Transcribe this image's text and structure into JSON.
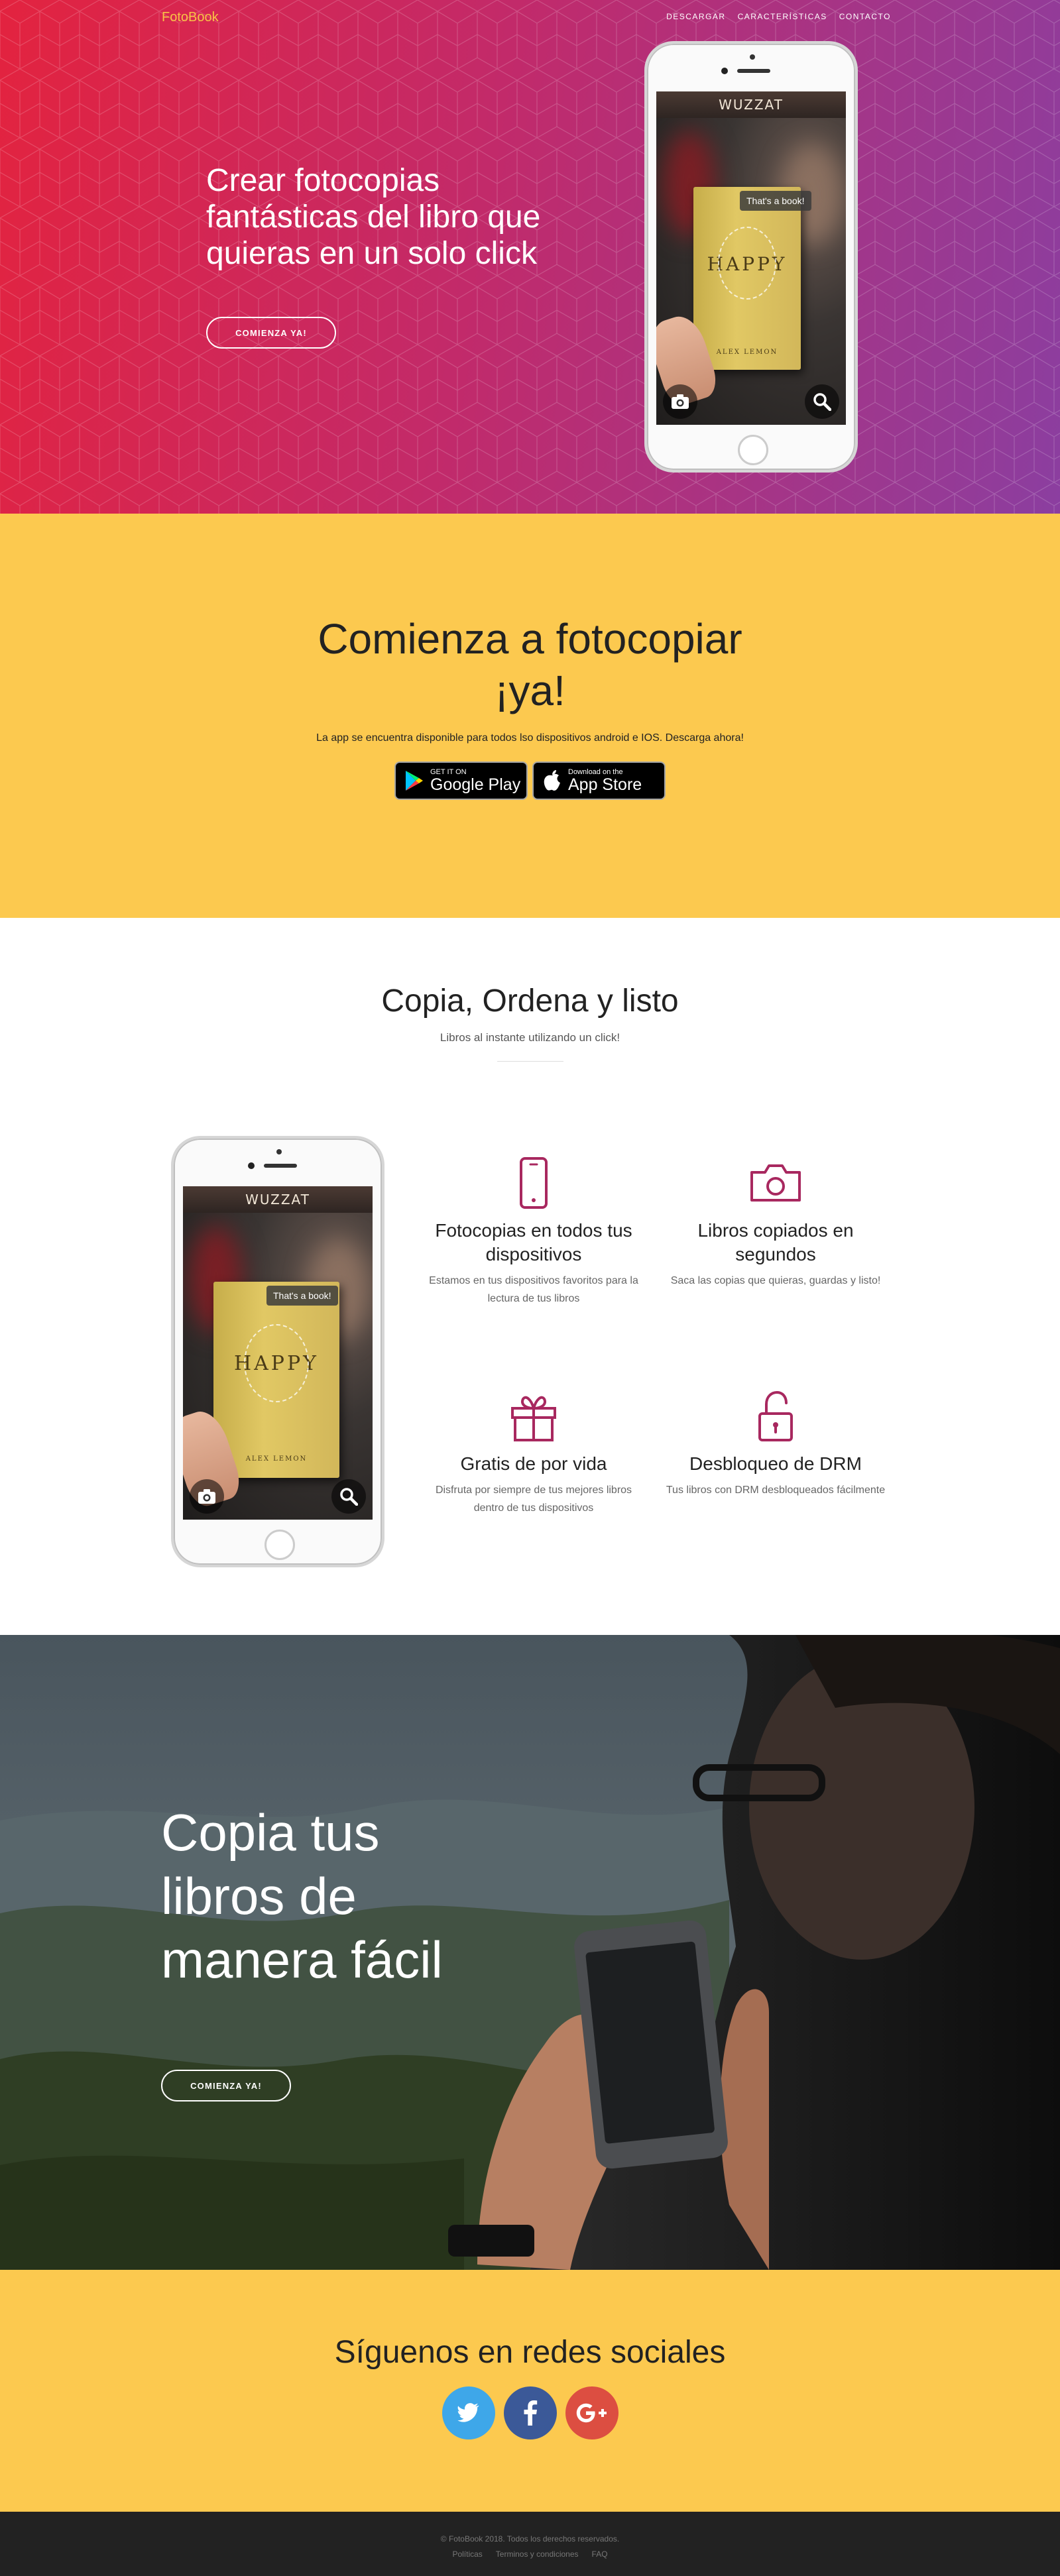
{
  "brand": "FotoBook",
  "nav": {
    "items": [
      "DESCARGAR",
      "CARACTERÍSTICAS",
      "CONTACTO"
    ]
  },
  "hero": {
    "title": "Crear fotocopias fantásticas del libro que quieras en un solo click",
    "button": "COMIENZA YA!"
  },
  "phone_screen": {
    "app_name": "WUZZAT",
    "bubble": "That's a book!",
    "book_title": "HAPPY",
    "book_author": "ALEX LEMON",
    "camera_icon": "camera-icon",
    "search_icon": "magnifier-icon"
  },
  "download": {
    "title": "Comienza a fotocopiar ¡ya!",
    "text": "La app se encuentra disponible para todos lso dispositivos android e IOS. Descarga ahora!",
    "google_small": "GET IT ON",
    "google_big": "Google Play",
    "apple_small": "Download on the",
    "apple_big": "App Store"
  },
  "features": {
    "title": "Copia, Ordena y listo",
    "subtitle": "Libros al instante utilizando un click!",
    "accent": "#a8285f",
    "items": [
      {
        "icon": "mobile-phone-icon",
        "title": "Fotocopias en todos tus dispositivos",
        "text": "Estamos en tus dispositivos favoritos para la lectura de tus libros"
      },
      {
        "icon": "camera-icon",
        "title": "Libros copiados en segundos",
        "text": "Saca las copias que quieras, guardas y listo!"
      },
      {
        "icon": "gift-icon",
        "title": "Gratis de por vida",
        "text": "Disfruta por siempre de tus mejores libros dentro de tus dispositivos"
      },
      {
        "icon": "unlocked-padlock-icon",
        "title": "Desbloqueo de DRM",
        "text": "Tus libros con DRM desbloqueados fácilmente"
      }
    ]
  },
  "cta": {
    "title": "Copia tus libros de manera fácil",
    "button": "COMIENZA YA!"
  },
  "social": {
    "title": "Síguenos en redes sociales",
    "twitter_color": "#3ea7e9",
    "facebook_color": "#3b5998",
    "google_color": "#dc4e41"
  },
  "footer": {
    "copyright": "© FotoBook 2018. Todos los derechos reservados.",
    "links": [
      "Políticas",
      "Terminos y condiciones",
      "FAQ"
    ]
  },
  "colors": {
    "hero_start": "#e3233f",
    "hero_end": "#8b3ea0",
    "yellow": "#fcc94f",
    "brand": "#f8c246",
    "footer_bg": "#222222"
  }
}
